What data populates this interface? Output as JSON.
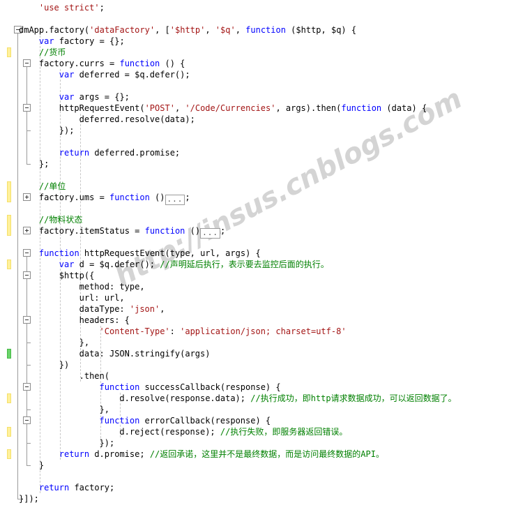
{
  "editor": {
    "watermark": "http://insus.cnblogs.com",
    "language": "javascript",
    "colors": {
      "background": "#ffffff",
      "text": "#000000",
      "keyword": "#0000ff",
      "string": "#a31515",
      "comment": "#008000",
      "guide": "#c8c8c8",
      "outline_rail": "#9a9a9a",
      "change_modified": "#fff09a",
      "change_saved": "#6ad46a"
    }
  },
  "code_lines": [
    {
      "n": 1,
      "indent": 4,
      "text": "'use strict';"
    },
    {
      "n": 2,
      "indent": 0,
      "text": ""
    },
    {
      "n": 3,
      "indent": 0,
      "text": "dmApp.factory('dataFactory', ['$http', '$q', function ($http, $q) {"
    },
    {
      "n": 4,
      "indent": 4,
      "text": "var factory = {};"
    },
    {
      "n": 5,
      "indent": 4,
      "text": "//货币"
    },
    {
      "n": 6,
      "indent": 4,
      "text": "factory.currs = function () {"
    },
    {
      "n": 7,
      "indent": 8,
      "text": "var deferred = $q.defer();"
    },
    {
      "n": 8,
      "indent": 0,
      "text": ""
    },
    {
      "n": 9,
      "indent": 8,
      "text": "var args = {};"
    },
    {
      "n": 10,
      "indent": 8,
      "text": "httpRequestEvent('POST', '/Code/Currencies', args).then(function (data) {"
    },
    {
      "n": 11,
      "indent": 12,
      "text": "deferred.resolve(data);"
    },
    {
      "n": 12,
      "indent": 8,
      "text": "});"
    },
    {
      "n": 13,
      "indent": 0,
      "text": ""
    },
    {
      "n": 14,
      "indent": 8,
      "text": "return deferred.promise;"
    },
    {
      "n": 15,
      "indent": 4,
      "text": "};"
    },
    {
      "n": 16,
      "indent": 0,
      "text": ""
    },
    {
      "n": 17,
      "indent": 4,
      "text": "//单位"
    },
    {
      "n": 18,
      "indent": 4,
      "text": "factory.ums = function ()...;"
    },
    {
      "n": 19,
      "indent": 0,
      "text": ""
    },
    {
      "n": 20,
      "indent": 4,
      "text": "//物料状态"
    },
    {
      "n": 21,
      "indent": 4,
      "text": "factory.itemStatus = function ()...;"
    },
    {
      "n": 22,
      "indent": 0,
      "text": ""
    },
    {
      "n": 23,
      "indent": 4,
      "text": "function httpRequestEvent(type, url, args) {"
    },
    {
      "n": 24,
      "indent": 8,
      "text": "var d = $q.defer(); //声明延后执行，表示要去监控后面的执行。"
    },
    {
      "n": 25,
      "indent": 8,
      "text": "$http({"
    },
    {
      "n": 26,
      "indent": 12,
      "text": "method: type,"
    },
    {
      "n": 27,
      "indent": 12,
      "text": "url: url,"
    },
    {
      "n": 28,
      "indent": 12,
      "text": "dataType: 'json',"
    },
    {
      "n": 29,
      "indent": 12,
      "text": "headers: {"
    },
    {
      "n": 30,
      "indent": 16,
      "text": "'Content-Type': 'application/json; charset=utf-8'"
    },
    {
      "n": 31,
      "indent": 12,
      "text": "},"
    },
    {
      "n": 32,
      "indent": 12,
      "text": "data: JSON.stringify(args)"
    },
    {
      "n": 33,
      "indent": 8,
      "text": "})"
    },
    {
      "n": 34,
      "indent": 12,
      "text": ".then("
    },
    {
      "n": 35,
      "indent": 16,
      "text": "function successCallback(response) {"
    },
    {
      "n": 36,
      "indent": 20,
      "text": "d.resolve(response.data); //执行成功，即http请求数据成功，可以返回数据了。"
    },
    {
      "n": 37,
      "indent": 16,
      "text": "},"
    },
    {
      "n": 38,
      "indent": 16,
      "text": "function errorCallback(response) {"
    },
    {
      "n": 39,
      "indent": 20,
      "text": "d.reject(response); //执行失败，即服务器返回错误。"
    },
    {
      "n": 40,
      "indent": 16,
      "text": "});"
    },
    {
      "n": 41,
      "indent": 8,
      "text": "return d.promise; //返回承诺，这里并不是最终数据，而是访问最终数据的API。"
    },
    {
      "n": 42,
      "indent": 4,
      "text": "}"
    },
    {
      "n": 43,
      "indent": 0,
      "text": ""
    },
    {
      "n": 44,
      "indent": 4,
      "text": "return factory;"
    },
    {
      "n": 45,
      "indent": 0,
      "text": "}]);"
    }
  ],
  "change_markers": [
    {
      "type": "modified",
      "line": 5
    },
    {
      "type": "modified",
      "line": 17
    },
    {
      "type": "modified",
      "line": 18
    },
    {
      "type": "modified",
      "line": 20
    },
    {
      "type": "modified",
      "line": 21
    },
    {
      "type": "modified",
      "line": 24
    },
    {
      "type": "saved",
      "line": 32
    },
    {
      "type": "modified",
      "line": 36
    },
    {
      "type": "modified",
      "line": 39
    },
    {
      "type": "modified",
      "line": 41
    }
  ],
  "fold_markers": [
    {
      "state": "collapsible",
      "line": 3
    },
    {
      "state": "collapsible",
      "line": 6
    },
    {
      "state": "collapsible",
      "line": 10
    },
    {
      "state": "collapsed",
      "line": 18
    },
    {
      "state": "collapsed",
      "line": 21
    },
    {
      "state": "collapsible",
      "line": 23
    },
    {
      "state": "collapsible",
      "line": 25
    },
    {
      "state": "collapsible",
      "line": 29
    },
    {
      "state": "collapsible",
      "line": 35
    },
    {
      "state": "collapsible",
      "line": 38
    }
  ]
}
